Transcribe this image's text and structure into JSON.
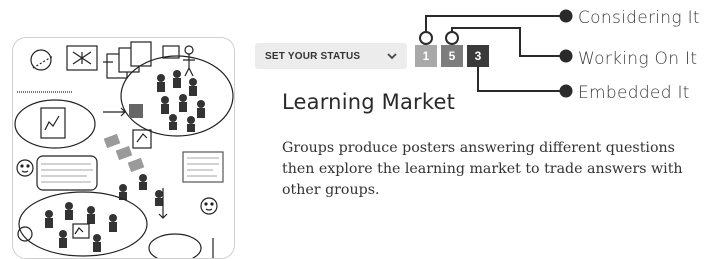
{
  "status": {
    "select_label": "SET YOUR STATUS",
    "levels": [
      "1",
      "5",
      "3"
    ],
    "legend": [
      "Considering It",
      "Working On It",
      "Embedded It"
    ]
  },
  "activity": {
    "title": "Learning Market",
    "description": "Groups produce posters answering different questions then explore the learning market to trade answers with other groups."
  },
  "icons": {
    "select_chevron": "chevron-down-icon",
    "illustration": "learning-market-diagram"
  },
  "colors": {
    "level_1": "#a9a9a9",
    "level_2": "#7d7d7d",
    "level_3": "#3a3a3a"
  }
}
